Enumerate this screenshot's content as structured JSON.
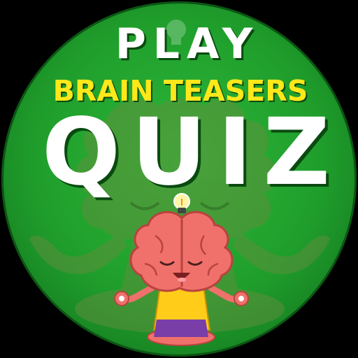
{
  "poster": {
    "line1": "PLAY",
    "line2": "BRAIN TEASERS",
    "line3": "QUIZ"
  },
  "colors": {
    "badge_green": "#1f9d2b",
    "badge_dark": "#0f6318",
    "title_white": "#ffffff",
    "title_yellow": "#ffe81a",
    "brain_pink": "#f0716b",
    "brain_outline": "#b8433f",
    "shirt_yellow": "#ffcc1a",
    "pants_purple": "#7a3ea8",
    "lightbulb": "#fff4a8"
  },
  "icons": {
    "background_character": "meditating-brain-silhouette-icon",
    "character": "meditating-brain-character-icon",
    "bulb": "lightbulb-icon"
  }
}
